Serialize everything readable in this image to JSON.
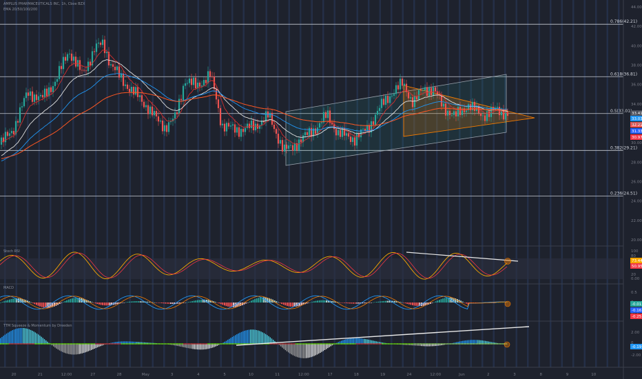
{
  "header": {
    "symbol_line": "AMPLUS PHARMACEUTICALS INC, 1h, Cboe BZX",
    "ema_line": "EMA 20/50/100/200"
  },
  "indicators": {
    "stoch": "Stoch RSI",
    "macd": "MACD",
    "ttm": "TTM Squeeze & Momentum by Dreeden"
  },
  "chart_data": {
    "type": "candlestick",
    "price_axis": {
      "min": 20,
      "max": 44,
      "ticks": [
        "44.00",
        "42.00",
        "40.00",
        "38.00",
        "36.00",
        "34.00",
        "32.00",
        "30.00",
        "28.00",
        "26.00",
        "24.00",
        "22.00",
        "20.00"
      ]
    },
    "time_axis_labels": [
      "20",
      "21",
      "12:00",
      "27",
      "28",
      "May",
      "3",
      "4",
      "5",
      "10",
      "11",
      "12:00",
      "17",
      "18",
      "19",
      "24",
      "12:00",
      "Jun",
      "2",
      "3",
      "8",
      "9",
      "10"
    ],
    "fib_levels": [
      {
        "label": "0.786(42.21)",
        "value": 42.21
      },
      {
        "label": "0.618(36.81)",
        "value": 36.81
      },
      {
        "label": "0.5(33.01)",
        "value": 33.01
      },
      {
        "label": "0.382(29.21)",
        "value": 29.21
      },
      {
        "label": "0.236(24.51)",
        "value": 24.51
      }
    ],
    "price_tags": [
      {
        "text": "33.41",
        "color": "#4a4e59",
        "value": 33.41
      },
      {
        "text": "33.03",
        "color": "#2196f3",
        "value": 33.03
      },
      {
        "text": "32.21",
        "color": "#ef5350",
        "value": 32.21
      },
      {
        "text": "31.33",
        "color": "#2962ff",
        "value": 31.33
      },
      {
        "text": "30.97",
        "color": "#f23645",
        "value": 30.97
      }
    ],
    "stoch_axis": [
      "100",
      "80",
      "20",
      "0.00"
    ],
    "stoch_tags": [
      {
        "text": "73.44",
        "color": "#f7a600"
      },
      {
        "text": "50.95",
        "color": "#f23645"
      }
    ],
    "macd_axis": [
      "0.5",
      "0",
      "-0.5"
    ],
    "macd_tags": [
      {
        "text": "-0.01",
        "color": "#26a69a"
      },
      {
        "text": "-0.16",
        "color": "#2962ff"
      },
      {
        "text": "-0.25",
        "color": "#f23645"
      }
    ],
    "ttm_axis": [
      "2.00",
      "0",
      "-2.00"
    ],
    "ttm_tags": [
      {
        "text": "-0.19",
        "color": "#2196f3"
      }
    ]
  }
}
